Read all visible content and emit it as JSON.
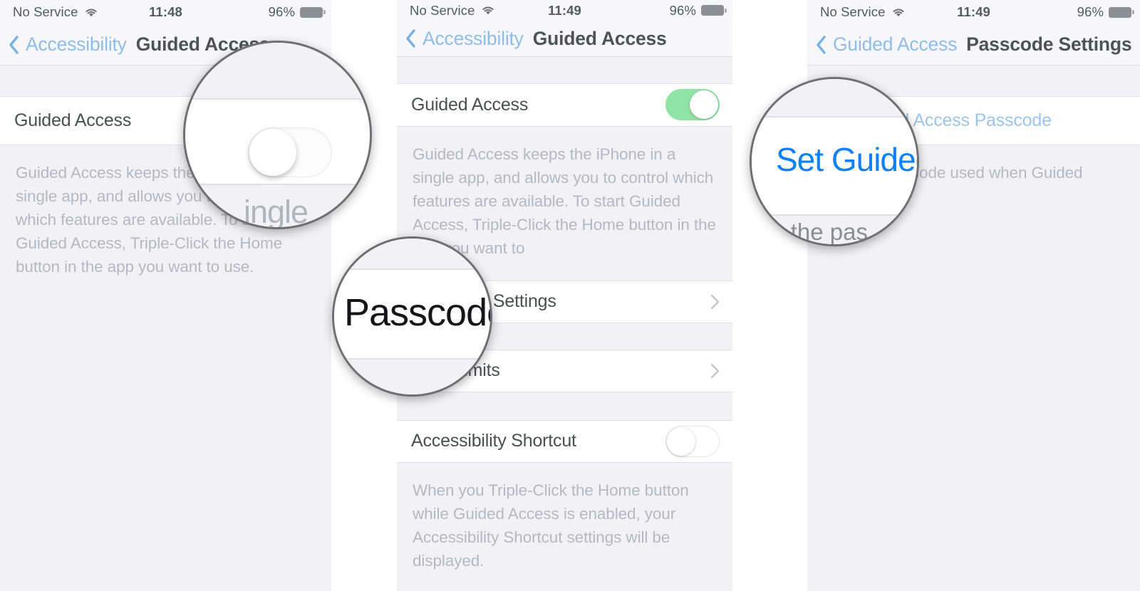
{
  "panels": [
    {
      "status": {
        "carrier": "No Service",
        "wifi_icon": "wifi-icon",
        "time": "11:48",
        "battery_pct": "96%",
        "battery_icon": "battery-icon"
      },
      "nav": {
        "back_icon": "chevron-left-icon",
        "back_label": "Accessibility",
        "title": "Guided Access"
      },
      "row_label": "Guided Access",
      "toggle_state": "off",
      "footnote": "Guided Access keeps the iPhone in a single app, and allows you to control which features are available. To start Guided Access, Triple-Click the Home button in the app you want to use."
    },
    {
      "status": {
        "carrier": "No Service",
        "wifi_icon": "wifi-icon",
        "time": "11:49",
        "battery_pct": "96%",
        "battery_icon": "battery-icon"
      },
      "nav": {
        "back_icon": "chevron-left-icon",
        "back_label": "Accessibility",
        "title": "Guided Access"
      },
      "row_label": "Guided Access",
      "toggle_state": "on",
      "footnote": "Guided Access keeps the iPhone in a single app, and allows you to control which features are available. To start Guided Access, Triple-Click the Home button in the app you want to",
      "rows": [
        {
          "label": "Passcode Settings",
          "accessory": "chevron-right-icon"
        },
        {
          "label": "Time Limits",
          "accessory": "chevron-right-icon"
        }
      ],
      "shortcut_row_label": "Accessibility Shortcut",
      "shortcut_toggle_state": "off",
      "shortcut_footnote": "When you Triple-Click the Home button while Guided Access is enabled, your Accessibility Shortcut settings will be displayed."
    },
    {
      "status": {
        "carrier": "No Service",
        "wifi_icon": "wifi-icon",
        "time": "11:49",
        "battery_pct": "96%",
        "battery_icon": "battery-icon"
      },
      "nav": {
        "back_icon": "chevron-left-icon",
        "back_label": "Guided Access",
        "title": "Passcode Settings"
      },
      "action_row_label": "Set Guided Access Passcode",
      "footnote": "Set the passcode used when Guided Access is"
    }
  ],
  "loupes": [
    {
      "name": "toggle-off-loupe",
      "text": "ingle"
    },
    {
      "name": "passcode-loupe",
      "text": "Passcode"
    },
    {
      "name": "set-guided-loupe",
      "text": "Set Guided",
      "text2": "et the pas"
    }
  ],
  "colors": {
    "page_background": "#ffffff",
    "panel_background": "#f1f1f6",
    "row_background": "#ffffff",
    "accent_blue": "#1080f5",
    "link_blue": "#9dc4ea",
    "toggle_on_green": "#8fe3a3",
    "text_primary": "#4b4e52",
    "text_muted": "#b7b8bf"
  }
}
